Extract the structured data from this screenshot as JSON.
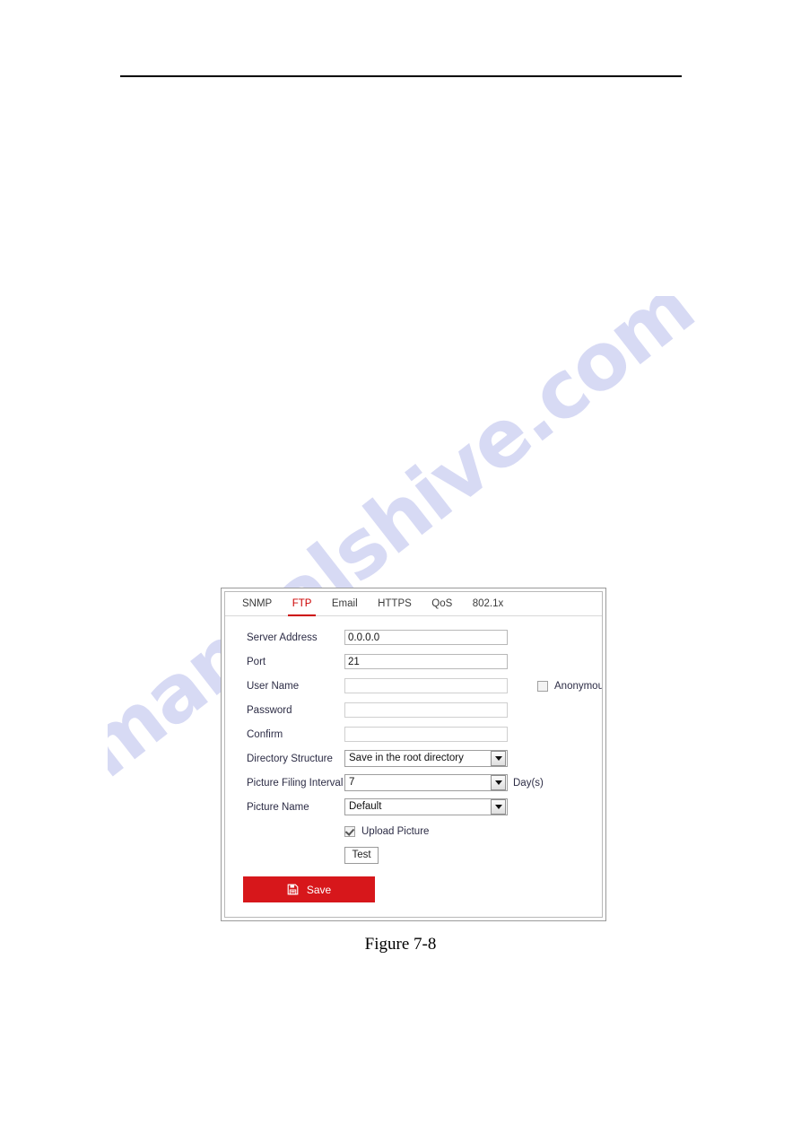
{
  "page": {
    "watermark_text": "manualshive.com",
    "caption": "Figure 7-8",
    "accent_color": "#cc0000",
    "save_button_color": "#d7171b"
  },
  "panel": {
    "tabs": [
      {
        "label": "SNMP",
        "active": false
      },
      {
        "label": "FTP",
        "active": true
      },
      {
        "label": "Email",
        "active": false
      },
      {
        "label": "HTTPS",
        "active": false
      },
      {
        "label": "QoS",
        "active": false
      },
      {
        "label": "802.1x",
        "active": false
      }
    ],
    "fields": {
      "server_address": {
        "label": "Server Address",
        "value": "0.0.0.0"
      },
      "port": {
        "label": "Port",
        "value": "21"
      },
      "user_name": {
        "label": "User Name",
        "value": ""
      },
      "password": {
        "label": "Password",
        "value": ""
      },
      "confirm": {
        "label": "Confirm",
        "value": ""
      },
      "directory_structure": {
        "label": "Directory Structure",
        "value": "Save in the root directory",
        "options": [
          "Save in the root directory"
        ]
      },
      "picture_filing_interval": {
        "label": "Picture Filing Interval",
        "value": "7",
        "unit": "Day(s)",
        "options": [
          "7"
        ]
      },
      "picture_name": {
        "label": "Picture Name",
        "value": "Default",
        "options": [
          "Default"
        ]
      }
    },
    "anonymous": {
      "label": "Anonymous",
      "checked": false
    },
    "upload_picture": {
      "label": "Upload Picture",
      "checked": true
    },
    "test_button": {
      "label": "Test"
    },
    "save_button": {
      "label": "Save",
      "icon": "save-floppy-icon"
    }
  }
}
